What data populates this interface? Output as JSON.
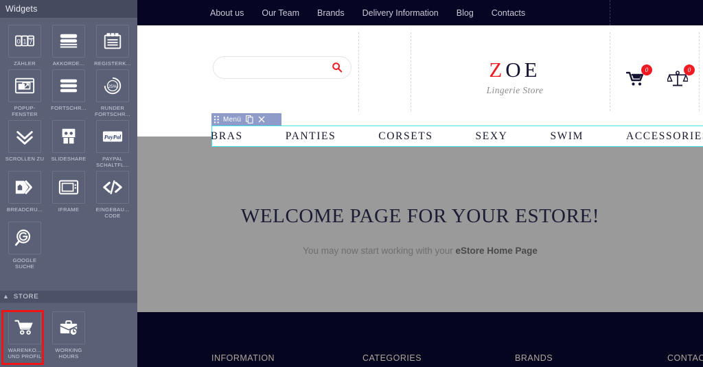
{
  "sidebar": {
    "title": "Widgets",
    "widgets": [
      {
        "label": "ZÄHLER",
        "icon": "counter-icon"
      },
      {
        "label": "AKKORDE...",
        "icon": "accordion-icon"
      },
      {
        "label": "REGISTERK...",
        "icon": "tabs-icon"
      },
      {
        "label": "POPUP-FENSTER",
        "icon": "popup-window-icon"
      },
      {
        "label": "FORTSCHR...",
        "icon": "progress-bar-icon"
      },
      {
        "label": "RUNDER FORTSCHR...",
        "icon": "circular-progress-icon"
      },
      {
        "label": "SCROLLEN ZU",
        "icon": "scroll-to-icon"
      },
      {
        "label": "SLIDESHARE",
        "icon": "slideshare-icon"
      },
      {
        "label": "PAYPAL SCHALTFL...",
        "icon": "paypal-button-icon"
      },
      {
        "label": "BREADCRU...",
        "icon": "breadcrumbs-icon"
      },
      {
        "label": "IFRAME",
        "icon": "iframe-icon"
      },
      {
        "label": "EINGEBAU... CODE",
        "icon": "embedded-code-icon"
      },
      {
        "label": "GOOGLE SUCHE",
        "icon": "google-search-icon"
      }
    ],
    "group": {
      "title": "STORE",
      "collapse_icon": "chevron-up-icon"
    },
    "store_widgets": [
      {
        "label": "WARENKO... UND PROFIL",
        "icon": "shopping-cart-icon",
        "selected": true
      },
      {
        "label": "WORKING HOURS",
        "icon": "briefcase-clock-icon",
        "selected": false
      }
    ],
    "selection_color": "#f01414"
  },
  "site": {
    "topnav": [
      "About us",
      "Our Team",
      "Brands",
      "Delivery Information",
      "Blog",
      "Contacts"
    ],
    "search": {
      "value": "",
      "placeholder": "",
      "icon": "search-icon",
      "icon_color": "#ee1b22"
    },
    "logo": {
      "first": "Z",
      "rest": "OE",
      "subtitle": "Lingerie Store",
      "first_color": "#ec1c24",
      "rest_color": "#141432"
    },
    "cart": {
      "icon": "shopping-cart-icon",
      "count": "0"
    },
    "compare": {
      "icon": "scales-icon",
      "count": "0"
    },
    "menu_widget": {
      "toolbar_label": "Menü",
      "drag_icon": "drag-handle-icon",
      "copy_icon": "copy-icon",
      "close_icon": "close-icon",
      "highlight_color": "#41e6e6",
      "items": [
        "BRAS",
        "PANTIES",
        "CORSETS",
        "SEXY",
        "SWIM",
        "ACCESSORIES"
      ]
    },
    "welcome": {
      "title": "WELCOME PAGE FOR YOUR ESTORE!",
      "subtitle_prefix": "You may now start working with your ",
      "subtitle_link": "eStore Home Page"
    },
    "footer_columns": [
      "INFORMATION",
      "CATEGORIES",
      "BRANDS",
      "CONTACTS"
    ]
  }
}
